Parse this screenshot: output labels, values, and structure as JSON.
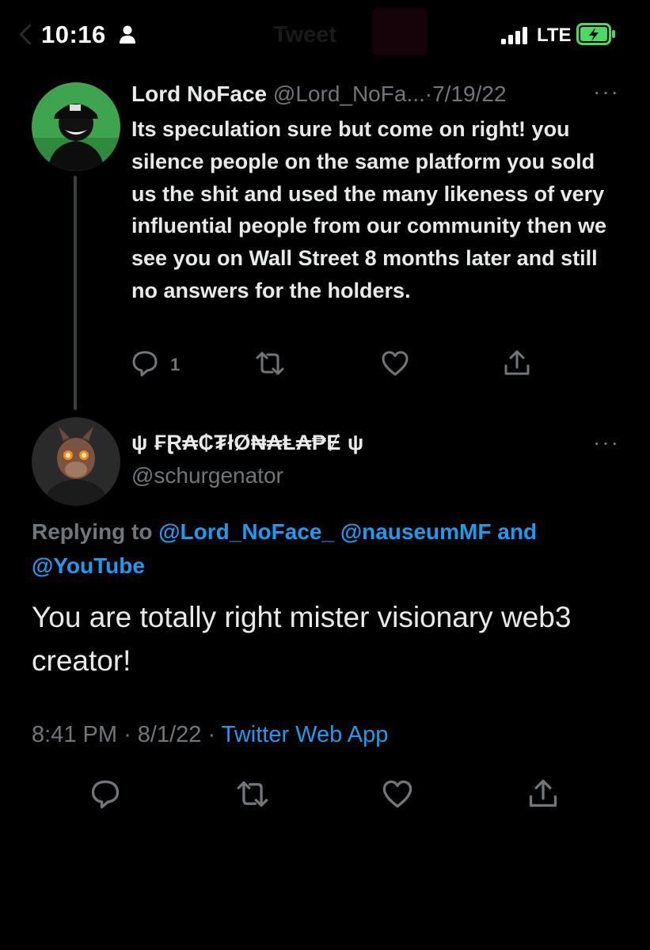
{
  "status_bar": {
    "time": "10:16",
    "network": "LTE",
    "background_title": "Tweet"
  },
  "tweet": {
    "author_name": "Lord NoFace",
    "author_handle": "@Lord_NoFa...",
    "separator": "·",
    "date": "7/19/22",
    "more": "···",
    "text": "Its speculation sure but come on right! you silence people on the same platform you sold us the shit and used the many likeness of very influential people from our community then we see you on Wall Street 8 months later and still no answers for the holders.",
    "reply_count": "1"
  },
  "reply": {
    "author_name": "ψ ₣Ɽ₳₵₮łØ₦₳Ⱡ₳₱Ɇ ψ",
    "author_handle": "@schurgenator",
    "more": "···",
    "replying_prefix": "Replying to",
    "replying_to_1": "@Lord_NoFace_",
    "replying_to_2": "@nauseumMF",
    "replying_and": "and",
    "replying_to_3": "@YouTube",
    "text": "You are totally right mister visionary web3 creator!",
    "time": "8:41 PM",
    "sep1": "·",
    "date": "8/1/22",
    "sep2": "·",
    "source": "Twitter Web App"
  },
  "colors": {
    "background": "#000000",
    "text": "#e7e9ea",
    "muted": "#71767b",
    "link": "#1d9bf0",
    "battery_fill": "#4cd964"
  },
  "icons": {
    "reply": "reply-icon",
    "retweet": "retweet-icon",
    "like": "like-icon",
    "share": "share-icon",
    "more": "more-icon"
  }
}
